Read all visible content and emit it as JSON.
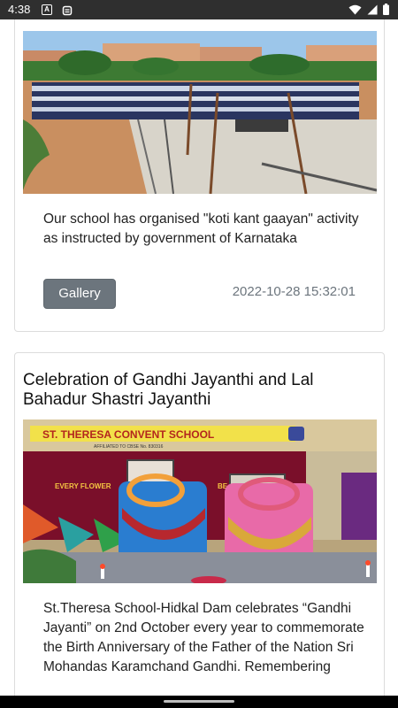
{
  "status_bar": {
    "time": "4:38",
    "notification_icons": [
      "a-app-icon",
      "storage-icon"
    ],
    "system_icons": [
      "wifi-icon",
      "signal-icon",
      "battery-icon"
    ]
  },
  "posts": [
    {
      "image_alt": "School assembly on campus ground",
      "description": "Our school has organised \"koti kant gaayan\" activity as instructed by government of Karnataka",
      "gallery_label": "Gallery",
      "timestamp": "2022-10-28 15:32:01"
    },
    {
      "title": "Celebration of Gandhi Jayanthi and Lal Bahadur Shastri Jayanthi",
      "image_banner": "ST. THERESA CONVENT SCHOOL",
      "image_sub_banner": "AFFILIATED TO CBSE No. 830316",
      "image_stage_text_left": "EVERY FLOWER",
      "image_stage_text_right": "BE IS",
      "description": "St.Theresa School-Hidkal Dam celebrates “Gandhi Jayanti” on 2nd October every year to commemorate the Birth Anniversary of the Father of the Nation Sri Mohandas Karamchand Gandhi. Remembering"
    }
  ],
  "colors": {
    "status_bar": "#2f2f2f",
    "button_gray": "#6c757d",
    "card_border": "#dcdcdc"
  }
}
